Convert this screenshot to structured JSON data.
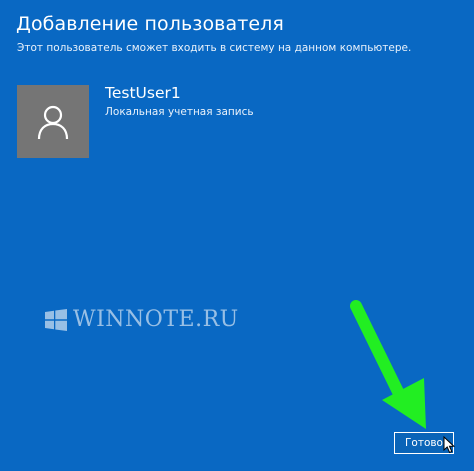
{
  "header": {
    "title": "Добавление пользователя",
    "subtitle": "Этот пользователь сможет входить в систему на данном компьютере."
  },
  "user": {
    "name": "TestUser1",
    "account_type": "Локальная учетная запись",
    "avatar_icon": "user-silhouette-icon",
    "tile_color": "#757575"
  },
  "watermark": {
    "text": "WINNOTE.RU",
    "icon": "windows-logo-icon"
  },
  "footer": {
    "done_label": "Готово"
  },
  "colors": {
    "background": "#0968c3",
    "annotation_arrow": "#22ee22"
  }
}
